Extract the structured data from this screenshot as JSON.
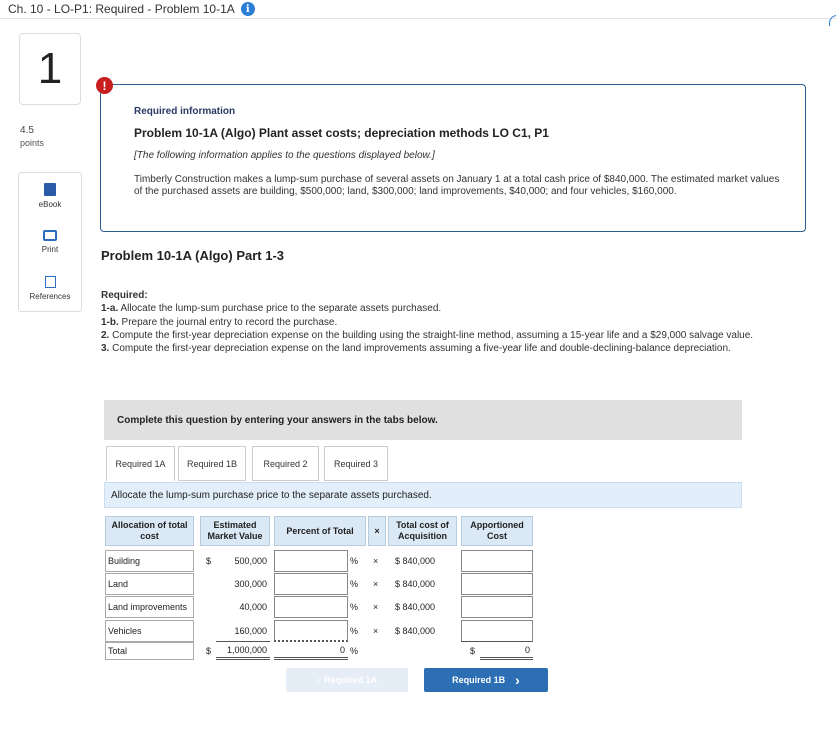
{
  "header": {
    "title": "Ch. 10 - LO-P1: Required - Problem 10-1A"
  },
  "question": {
    "number": "1",
    "points_value": "4.5",
    "points_label": "points"
  },
  "tools": [
    {
      "label": "eBook"
    },
    {
      "label": "Print"
    },
    {
      "label": "References"
    }
  ],
  "info": {
    "heading": "Required information",
    "title": "Problem 10-1A (Algo) Plant asset costs; depreciation methods LO C1, P1",
    "note": "[The following information applies to the questions displayed below.]",
    "scenario": "Timberly Construction makes a lump-sum purchase of several assets on January 1 at a total cash price of $840,000. The estimated market values of the purchased assets are building, $500,000; land, $300,000; land improvements, $40,000; and four vehicles, $160,000."
  },
  "part_title": "Problem 10-1A (Algo) Part 1-3",
  "required": {
    "heading": "Required:",
    "items": [
      {
        "key": "1-a.",
        "text": " Allocate the lump-sum purchase price to the separate assets purchased."
      },
      {
        "key": "1-b.",
        "text": " Prepare the journal entry to record the purchase."
      },
      {
        "key": "2.",
        "text": " Compute the first-year depreciation expense on the building using the straight-line method, assuming a 15-year life and a $29,000 salvage value."
      },
      {
        "key": "3.",
        "text": " Compute the first-year depreciation expense on the land improvements assuming a five-year life and double-declining-balance depreciation."
      }
    ]
  },
  "complete_bar": "Complete this question by entering your answers in the tabs below.",
  "tabs": [
    {
      "label": "Required 1A"
    },
    {
      "label": "Required 1B"
    },
    {
      "label": "Required 2"
    },
    {
      "label": "Required 3"
    }
  ],
  "instruction": "Allocate the lump-sum purchase price to the separate assets purchased.",
  "table": {
    "headers": {
      "allocation": "Allocation of total cost",
      "market": "Estimated Market Value",
      "percent": "Percent of Total",
      "times": "×",
      "total_cost": "Total cost of Acquisition",
      "apportioned": "Apportioned Cost"
    },
    "rows": [
      {
        "label": "Building",
        "dollar": "$",
        "market": "500,000",
        "pct_sign": "%",
        "x": "×",
        "cost": "$ 840,000"
      },
      {
        "label": "Land",
        "dollar": "",
        "market": "300,000",
        "pct_sign": "%",
        "x": "×",
        "cost": "$ 840,000"
      },
      {
        "label": "Land improvements",
        "dollar": "",
        "market": "40,000",
        "pct_sign": "%",
        "x": "×",
        "cost": "$ 840,000"
      },
      {
        "label": "Vehicles",
        "dollar": "",
        "market": "160,000",
        "pct_sign": "%",
        "x": "×",
        "cost": "$ 840,000"
      }
    ],
    "total": {
      "label": "Total",
      "dollar": "$",
      "market": "1,000,000",
      "pct": "0",
      "pct_sign": "%",
      "ap_dollar": "$",
      "ap_value": "0"
    }
  },
  "nav": {
    "prev": "Required 1A",
    "next": "Required 1B"
  },
  "colors": {
    "accent": "#2d6fb5",
    "alert": "#c81e1e",
    "header_fill": "#dbe8f5"
  }
}
